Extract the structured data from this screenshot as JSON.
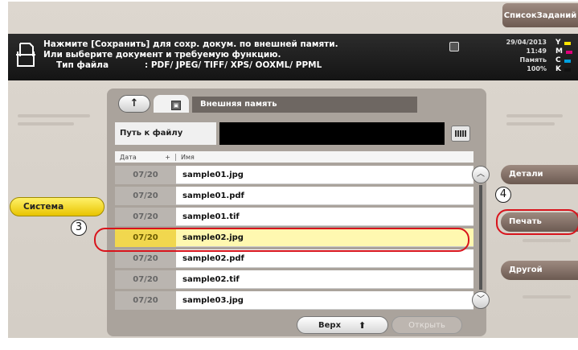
{
  "header": {
    "joblist_label": "СписокЗаданий",
    "message_line1": "Нажмите [Сохранить] для сохр. докум. по внешней памяти.",
    "message_line2": "Или выберите документ и требуемую функцию.",
    "file_type_label": "Тип файла",
    "file_type_value": ": PDF/ JPEG/ TIFF/ XPS/ OOXML/ PPML",
    "date": "29/04/2013",
    "time": "11:49",
    "memory_label": "Память",
    "memory_value": "100%",
    "toner": [
      {
        "letter": "Y",
        "color": "#ffe600"
      },
      {
        "letter": "M",
        "color": "#e0007a"
      },
      {
        "letter": "C",
        "color": "#00a0e0"
      },
      {
        "letter": "K",
        "color": "#111111"
      }
    ]
  },
  "left_tab": {
    "label": "Система"
  },
  "panel": {
    "storage_label": "Внешняя память",
    "path_label": "Путь к файлу",
    "columns": {
      "date": "Дата",
      "sort": "+",
      "name": "Имя"
    },
    "files": [
      {
        "date": "07/20",
        "name": "sample01.jpg"
      },
      {
        "date": "07/20",
        "name": "sample01.pdf"
      },
      {
        "date": "07/20",
        "name": "sample01.tif"
      },
      {
        "date": "07/20",
        "name": "sample02.jpg"
      },
      {
        "date": "07/20",
        "name": "sample02.pdf"
      },
      {
        "date": "07/20",
        "name": "sample02.tif"
      },
      {
        "date": "07/20",
        "name": "sample03.jpg"
      }
    ],
    "selected_index": 3,
    "top_button": "Верх",
    "open_button": "Открыть"
  },
  "side_buttons": {
    "details": "Детали",
    "print": "Печать",
    "other": "Другой"
  },
  "callouts": {
    "three": "3",
    "four": "4"
  },
  "colors": {
    "selection": "#fff8b0",
    "highlight_ring": "#d8141c",
    "system_tab": "#f5d81e"
  }
}
